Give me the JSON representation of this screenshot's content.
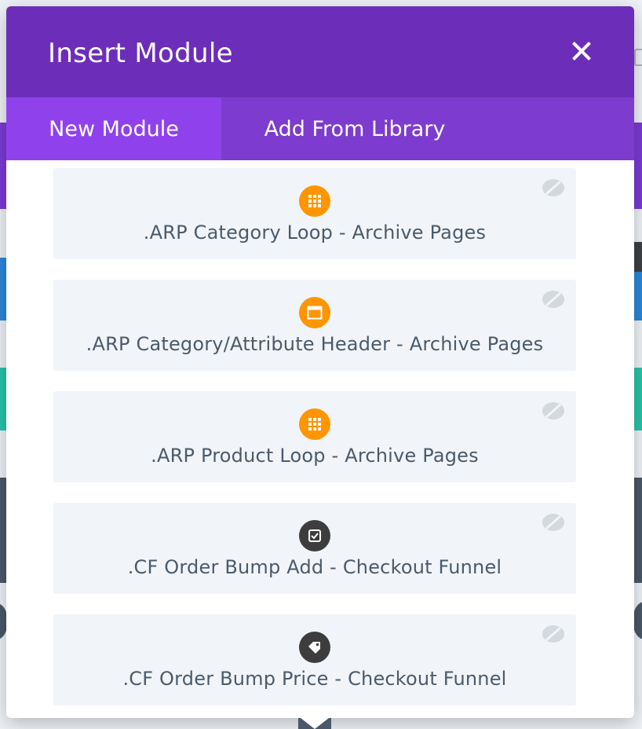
{
  "modal": {
    "title": "Insert Module",
    "close_icon": "close-icon"
  },
  "tabs": [
    {
      "label": "New Module",
      "active": true
    },
    {
      "label": "Add From Library",
      "active": false
    }
  ],
  "modules": [
    {
      "label": ".ARP Category Loop - Archive Pages",
      "icon": "grid-icon",
      "icon_color": "#ff9500"
    },
    {
      "label": ".ARP Category/Attribute Header - Archive Pages",
      "icon": "window-icon",
      "icon_color": "#ff9500"
    },
    {
      "label": ".ARP Product Loop - Archive Pages",
      "icon": "grid-icon",
      "icon_color": "#ff9500"
    },
    {
      "label": ".CF Order Bump Add - Checkout Funnel",
      "icon": "checkbox-icon",
      "icon_color": "#3d3d3d"
    },
    {
      "label": ".CF Order Bump Price - Checkout Funnel",
      "icon": "price-tag-icon",
      "icon_color": "#3d3d3d"
    }
  ],
  "colors": {
    "header_bg": "#6c2eb9",
    "tabs_bg": "#7d3bcf",
    "active_tab_bg": "#8f42ec",
    "card_bg": "#f1f5f9",
    "label_text": "#4b5a6b"
  }
}
